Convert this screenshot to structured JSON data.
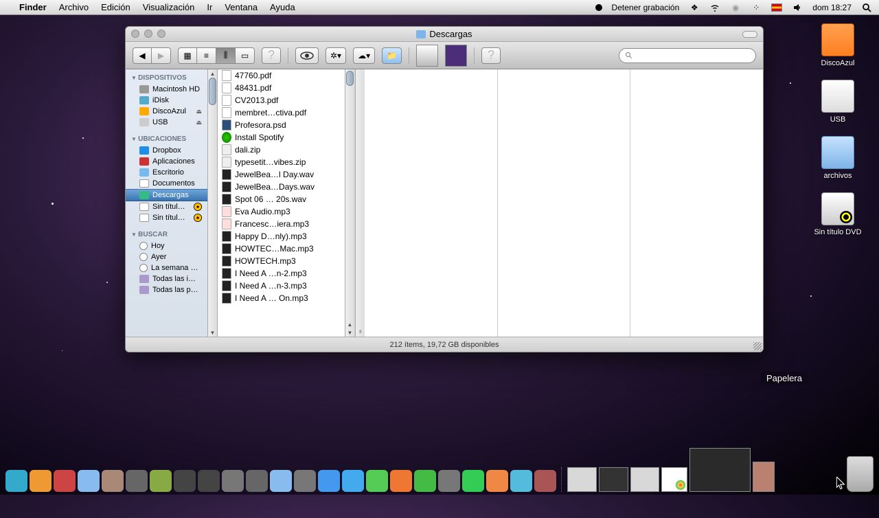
{
  "menubar": {
    "app": "Finder",
    "menus": [
      "Archivo",
      "Edición",
      "Visualización",
      "Ir",
      "Ventana",
      "Ayuda"
    ],
    "recording": "Detener grabación",
    "clock": "dom 18:27"
  },
  "desktop": {
    "discoazul": "DiscoAzul",
    "usb": "USB",
    "archivos": "archivos",
    "dvd": "Sin título DVD",
    "papelera_label": "Papelera"
  },
  "finder": {
    "title": "Descargas",
    "search_placeholder": "",
    "status": "212 ítems, 19,72 GB disponibles",
    "sidebar": {
      "devices_header": "DISPOSITIVOS",
      "devices": [
        {
          "label": "Macintosh HD",
          "icon": "ic-hd"
        },
        {
          "label": "iDisk",
          "icon": "ic-idisk"
        },
        {
          "label": "DiscoAzul",
          "icon": "ic-ext",
          "eject": true
        },
        {
          "label": "USB",
          "icon": "ic-usb",
          "eject": true
        }
      ],
      "places_header": "UBICACIONES",
      "places": [
        {
          "label": "Dropbox",
          "icon": "ic-db"
        },
        {
          "label": "Aplicaciones",
          "icon": "ic-app"
        },
        {
          "label": "Escritorio",
          "icon": "ic-desk"
        },
        {
          "label": "Documentos",
          "icon": "ic-doc"
        },
        {
          "label": "Descargas",
          "icon": "ic-dl",
          "selected": true
        },
        {
          "label": "Sin títul…",
          "icon": "ic-doc",
          "burn": true
        },
        {
          "label": "Sin títul…",
          "icon": "ic-doc",
          "burn": true
        }
      ],
      "search_header": "BUSCAR",
      "search": [
        {
          "label": "Hoy",
          "icon": "ic-clock"
        },
        {
          "label": "Ayer",
          "icon": "ic-clock"
        },
        {
          "label": "La semana …",
          "icon": "ic-clock"
        },
        {
          "label": "Todas las i…",
          "icon": "ic-sf"
        },
        {
          "label": "Todas las p…",
          "icon": "ic-sf"
        }
      ]
    },
    "files": [
      {
        "name": "47760.pdf",
        "icon": "fi-pdf"
      },
      {
        "name": "48431.pdf",
        "icon": "fi-pdf"
      },
      {
        "name": "CV2013.pdf",
        "icon": "fi-pdf"
      },
      {
        "name": "membret…ctiva.pdf",
        "icon": "fi-pdf"
      },
      {
        "name": "Profesora.psd",
        "icon": "fi-psd"
      },
      {
        "name": "Install Spotify",
        "icon": "fi-pkg"
      },
      {
        "name": "dali.zip",
        "icon": "fi-zip"
      },
      {
        "name": "typesetit…vibes.zip",
        "icon": "fi-zip"
      },
      {
        "name": "JewelBea…l Day.wav",
        "icon": "fi-audio"
      },
      {
        "name": "JewelBea…Days.wav",
        "icon": "fi-audio"
      },
      {
        "name": "Spot 06 … 20s.wav",
        "icon": "fi-audio"
      },
      {
        "name": "Eva Audio.mp3",
        "icon": "fi-audio2"
      },
      {
        "name": "Francesc…iera.mp3",
        "icon": "fi-audio2"
      },
      {
        "name": "Happy D…nly).mp3",
        "icon": "fi-audio"
      },
      {
        "name": "HOWTEC…Mac.mp3",
        "icon": "fi-audio"
      },
      {
        "name": "HOWTECH.mp3",
        "icon": "fi-audio"
      },
      {
        "name": "I Need A …n-2.mp3",
        "icon": "fi-audio"
      },
      {
        "name": "I Need A …n-3.mp3",
        "icon": "fi-audio"
      },
      {
        "name": "I Need A … On.mp3",
        "icon": "fi-audio"
      }
    ]
  },
  "dock_colors": [
    "#3ac",
    "#e93",
    "#c44",
    "#8be",
    "#a87",
    "#666",
    "#8a4",
    "#444",
    "#444",
    "#777",
    "#666",
    "#8be",
    "#777",
    "#49e",
    "#4ae",
    "#5c5",
    "#e73",
    "#4b4",
    "#777",
    "#3c5",
    "#e84",
    "#5bd",
    "#a55"
  ]
}
